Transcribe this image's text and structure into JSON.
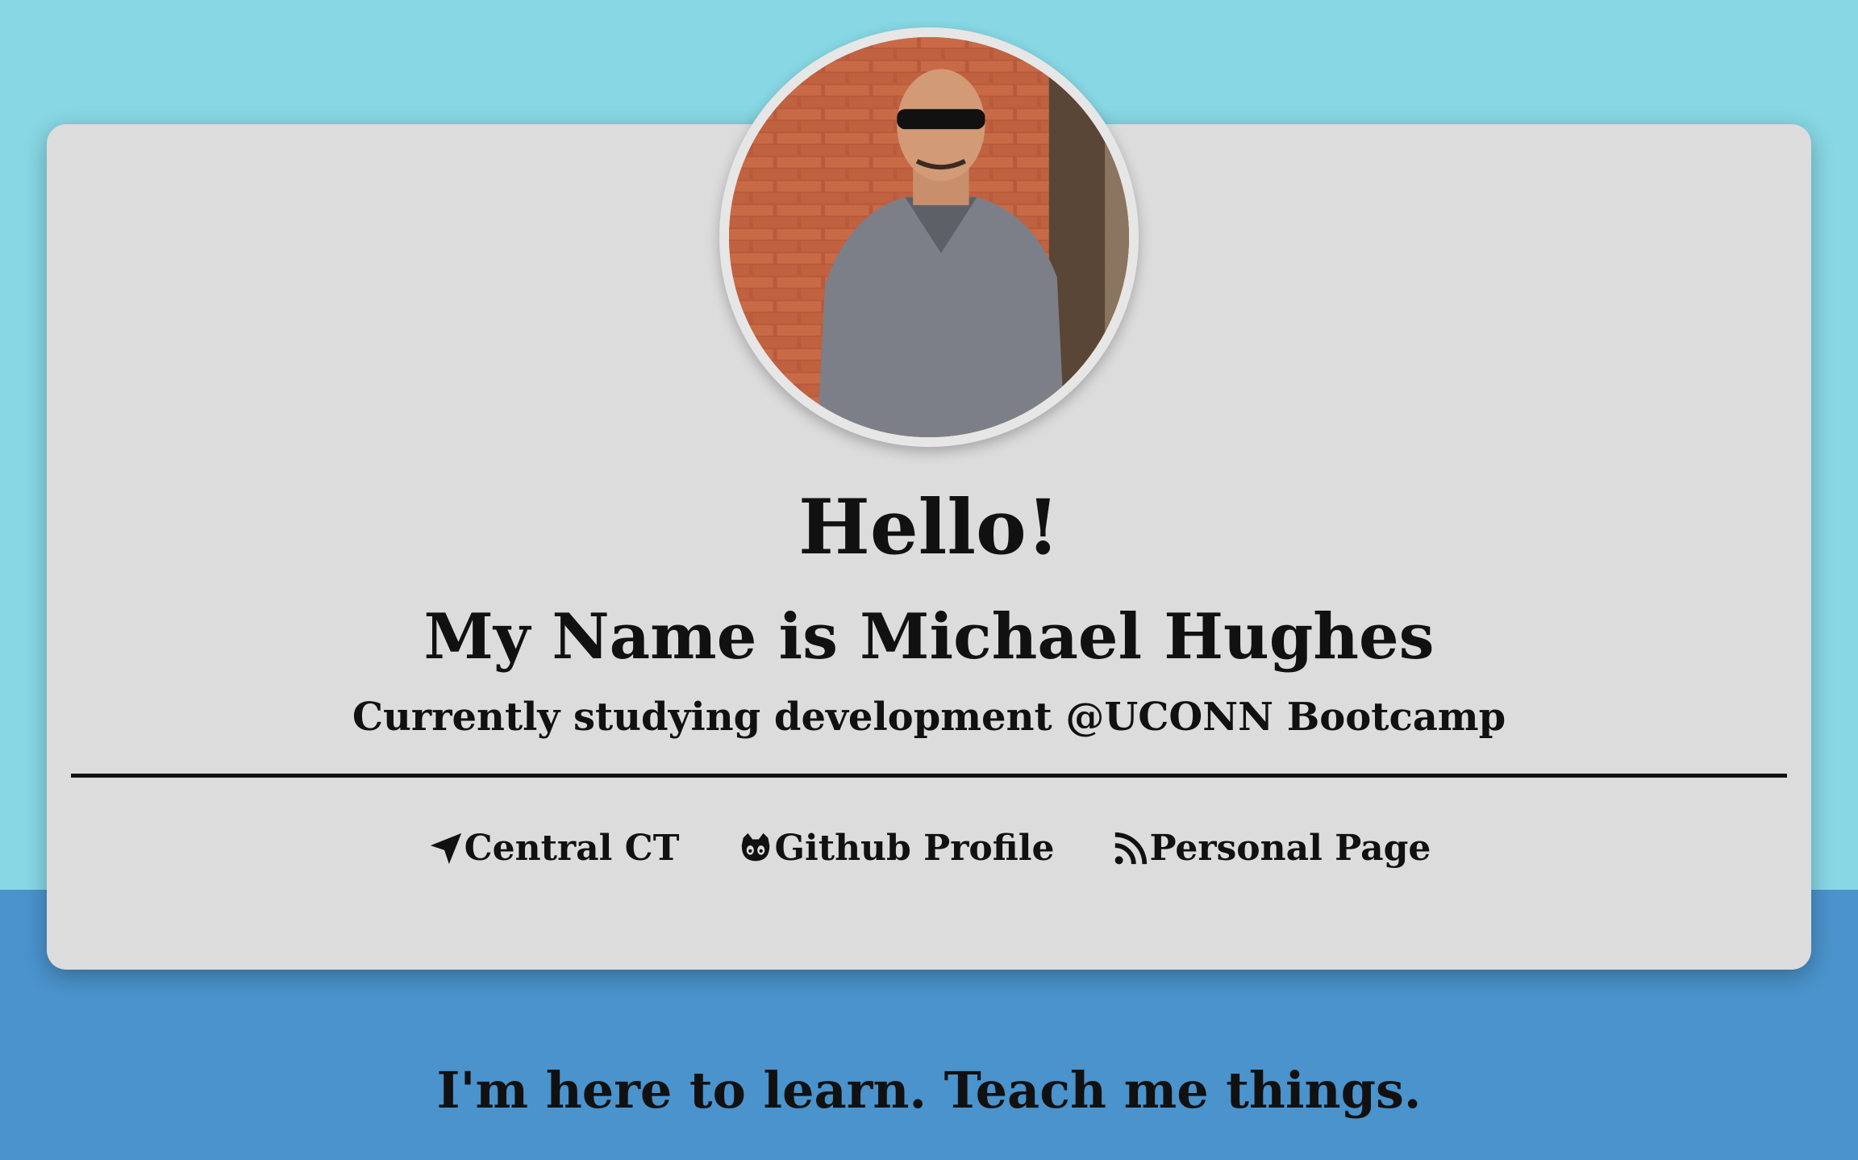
{
  "profile": {
    "greeting": "Hello!",
    "name_line": "My Name is Michael Hughes",
    "subtitle": "Currently studying development @UCONN Bootcamp"
  },
  "links": [
    {
      "icon": "location-arrow-icon",
      "label": "Central CT"
    },
    {
      "icon": "github-icon",
      "label": "Github Profile"
    },
    {
      "icon": "rss-icon",
      "label": "Personal Page"
    }
  ],
  "footer": {
    "tagline": "I'm here to learn. Teach me things."
  },
  "colors": {
    "sky_top": "#87d7e4",
    "blue_bottom": "#4a93cc",
    "card": "#dcdcdc",
    "text": "#111111"
  }
}
